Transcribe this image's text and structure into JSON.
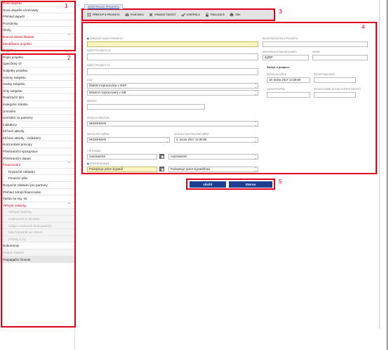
{
  "sidebar": {
    "items": [
      {
        "label": "Profil objektu",
        "style": "red",
        "chevron": "^"
      },
      {
        "label": "Nová depeše a koncepty",
        "style": ""
      },
      {
        "label": "Přehled depeší",
        "style": ""
      },
      {
        "label": "Poznámky",
        "style": ""
      },
      {
        "label": "Úkoly",
        "style": ""
      },
      {
        "label": "Datová oblast žádosti",
        "style": "red",
        "chevron": "^"
      },
      {
        "label": "Identifikace projektu",
        "style": "red"
      },
      {
        "label": "Projekt",
        "style": ""
      },
      {
        "label": "Popis projektu",
        "style": ""
      },
      {
        "label": "Specifický cíl",
        "style": ""
      },
      {
        "label": "Subjekty projektu",
        "style": ""
      },
      {
        "label": "Adresy subjektu",
        "style": ""
      },
      {
        "label": "Osoby subjektu",
        "style": ""
      },
      {
        "label": "Účty subjektu",
        "style": ""
      },
      {
        "label": "Realizační tým",
        "style": ""
      },
      {
        "label": "Kategorie zásahu",
        "style": ""
      },
      {
        "label": "Umístění",
        "style": ""
      },
      {
        "label": "Umístění za partnery",
        "style": ""
      },
      {
        "label": "Indikátory",
        "style": ""
      },
      {
        "label": "Klíčové aktivity",
        "style": ""
      },
      {
        "label": "Klíčové aktivity - indikátory",
        "style": ""
      },
      {
        "label": "Horizontální principy",
        "style": ""
      },
      {
        "label": "Přeshraniční spolupráce",
        "style": ""
      },
      {
        "label": "Přeshraniční dopad",
        "style": ""
      },
      {
        "label": "Financování",
        "style": "red",
        "chevron": "^"
      },
      {
        "label": "Rozpočet základní",
        "style": "sub"
      },
      {
        "label": "Finanční plán",
        "style": "sub"
      },
      {
        "label": "Rozpočet základní pro partnery",
        "style": ""
      },
      {
        "label": "Přehled zdrojů financování",
        "style": ""
      },
      {
        "label": "Vazba na reg. str.",
        "style": ""
      },
      {
        "label": "Veřejné zakázky",
        "style": "red",
        "chevron": "^"
      },
      {
        "label": "Veřejné zakázky",
        "style": "sub disabled"
      },
      {
        "label": "Hodnocení a odvolání",
        "style": "sub disabled"
      },
      {
        "label": "Údaje o smluvně dodavatelích",
        "style": "sub disabled"
      },
      {
        "label": "Návrh/podnět na ÚOHS",
        "style": "sub disabled"
      },
      {
        "label": "Přílohy k VZ",
        "style": "sub disabled"
      },
      {
        "label": "Dokumenty",
        "style": ""
      },
      {
        "label": "Podpis žádosti",
        "style": "disabled"
      },
      {
        "label": "Propagační činnost",
        "style": "grey"
      }
    ]
  },
  "markers": {
    "m1": "1",
    "m2": "2",
    "m3": "3",
    "m4": "4",
    "m5": "5"
  },
  "top_tab": "IDENTIFIKACE PROJEKTU",
  "toolbar": {
    "buttons": [
      {
        "label": "PŘESTUP K PROJEKTU",
        "icon": "grid-icon"
      },
      {
        "label": "PLNÉ MOCI",
        "icon": "envelope-icon"
      },
      {
        "label": "VYMAZAT ŽÁDOST",
        "icon": "x-icon"
      },
      {
        "label": "KONTROLA",
        "icon": "check-icon"
      },
      {
        "label": "FINALIZACE",
        "icon": "lock-icon"
      },
      {
        "label": "TISK",
        "icon": "print-icon"
      }
    ]
  },
  "form": {
    "name_cz_label": "ZKRÁCENÝ NÁZEV PROJEKTU",
    "name_cz_value": "",
    "reg_label": "REGISTRAČNÍ ČÍSLO PROJEKTU",
    "name_en_label": "NÁZEV PROJEKTU CZ",
    "ident_label": "IDENTIFIKACE ŽÁDOSTI (HASH)",
    "ident_value": "dgfDP",
    "verze_label": "VERZE",
    "name_pl_label": "NÁZEV PROJEKTU PL",
    "zadost_label": "Žádost o podporu",
    "datum_zalozeni_label": "DATUM ZALOŽENÍ",
    "datum_zalozeni_value": "19. ledna 2017 13:25:59",
    "datum_finalizace_label": "DATUM FINALIZACE",
    "stav_label": "STAV",
    "stav1": "Žádost rozpracována v ISKP",
    "stav2": "Mrazení rozpracovaný v SIB",
    "datum_podpisu_label": "DATUM PODPISU",
    "datum_podani_label": "DATUM PODÁNÍ AKTUÁLNÍ VERZE ŽÁDOSTI",
    "proces_label": "PROCES",
    "spravce_label": "SPRÁVCE PŘÍSTUPU",
    "spravce_value": "NKDOHMAR",
    "naposledy_label": "NAPOSLEDY ZMĚNIL",
    "naposledy_value": "NKDOHMAR",
    "datum_zmeny_label": "DATUM A ČAS POSLEDNÍ ZMĚNY",
    "datum_zmeny_value": "2. února 2017 14:35:58",
    "typ_podani_label": "TYP PODÁNÍ",
    "typ_podani_value": "Automatické",
    "typ_podani_value2": "Automatické",
    "zpusob_label": "ZPŮSOB JEDNÁNÍ",
    "zpusob_value": "Podepisuje jeden signatář",
    "zpusob_value2": "Podepisuje jeden signatář(náz"
  },
  "buttons": {
    "save": "Uložit",
    "cancel": "Storno"
  },
  "colors": {
    "accent_red": "#e0001b",
    "brand_blue": "#1d3f91",
    "required_yellow": "#fdf6c2"
  }
}
